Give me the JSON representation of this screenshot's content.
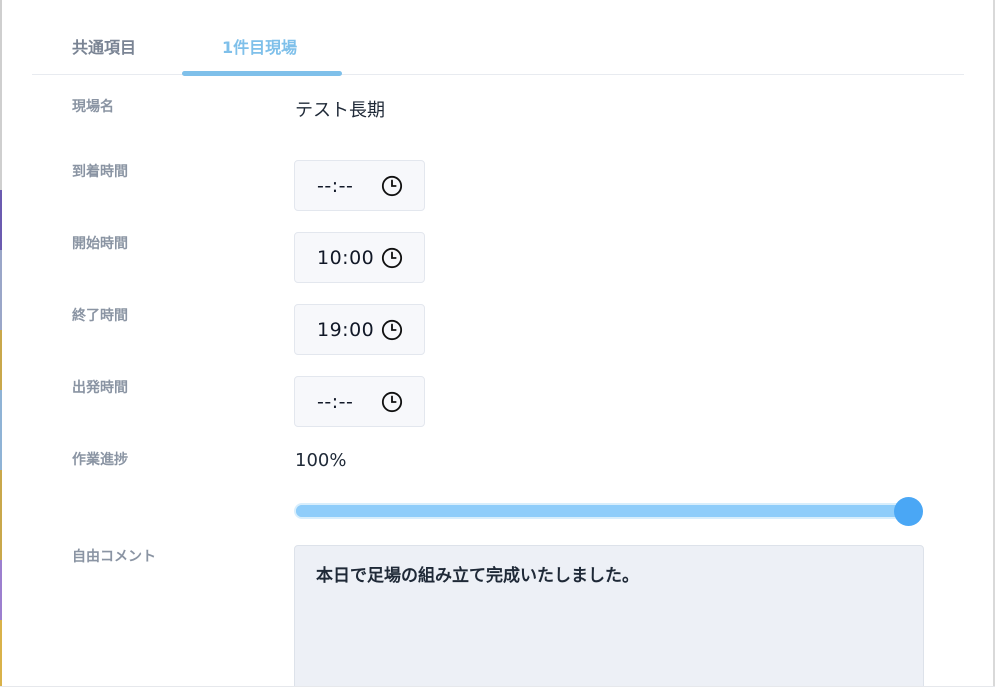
{
  "tabs": {
    "common": "共通項目",
    "site": "1件目現場"
  },
  "fields": {
    "site_name": {
      "label": "現場名",
      "value": "テスト長期"
    },
    "arrival_time": {
      "label": "到着時間",
      "value": "--:--"
    },
    "start_time": {
      "label": "開始時間",
      "value": "10:00"
    },
    "end_time": {
      "label": "終了時間",
      "value": "19:00"
    },
    "departure_time": {
      "label": "出発時間",
      "value": "--:--"
    },
    "progress": {
      "label": "作業進捗",
      "value_text": "100%",
      "value": 100
    },
    "comment": {
      "label": "自由コメント",
      "value": "本日で足場の組み立て完成いたしました。"
    }
  },
  "colors": {
    "accent": "#7fc0ea",
    "slider_track": "#8fcdfa",
    "slider_thumb": "#4aa7f5"
  },
  "icons": {
    "time_picker": "clock-icon"
  }
}
